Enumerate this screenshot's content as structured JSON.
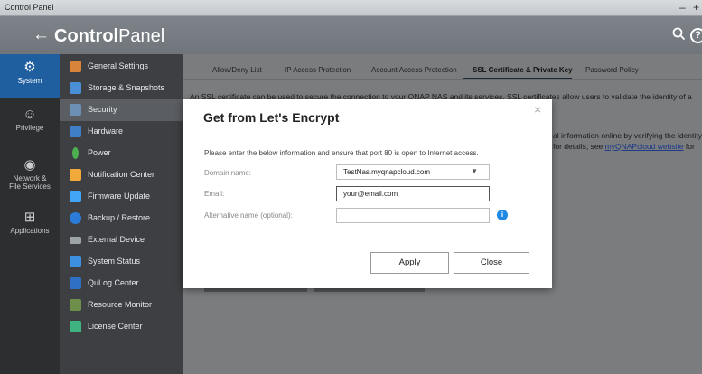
{
  "window": {
    "title": "Control Panel",
    "minimize": "–",
    "more": "+"
  },
  "header": {
    "back": "←",
    "title_bold": "Control",
    "title_rest": "Panel",
    "search": "🔍",
    "help": "?"
  },
  "rail": [
    {
      "label": "System",
      "icon": "⚙"
    },
    {
      "label": "Privilege",
      "icon": "☺"
    },
    {
      "label": "Network &",
      "label2": "File Services",
      "icon": "◉"
    },
    {
      "label": "Applications",
      "icon": "⊞"
    }
  ],
  "menu": [
    {
      "label": "General Settings",
      "color": "#d9843b"
    },
    {
      "label": "Storage & Snapshots",
      "color": "#4a8fd6"
    },
    {
      "label": "Security",
      "color": "#6d8fb3"
    },
    {
      "label": "Hardware",
      "color": "#3f7fc7"
    },
    {
      "label": "Power",
      "color": "#4caf50"
    },
    {
      "label": "Notification Center",
      "color": "#f2a93b"
    },
    {
      "label": "Firmware Update",
      "color": "#42a5f5"
    },
    {
      "label": "Backup / Restore",
      "color": "#2b7bd8"
    },
    {
      "label": "External Device",
      "color": "#9ea3a8"
    },
    {
      "label": "System Status",
      "color": "#3d8fe0"
    },
    {
      "label": "QuLog Center",
      "color": "#2f6fc4"
    },
    {
      "label": "Resource Monitor",
      "color": "#6d8f4a"
    },
    {
      "label": "License Center",
      "color": "#3fb37f"
    }
  ],
  "tabs": [
    {
      "label": "Allow/Deny List"
    },
    {
      "label": "IP Access Protection"
    },
    {
      "label": "Account Access Protection"
    },
    {
      "label": "SSL Certificate & Private Key"
    },
    {
      "label": "Password Policy"
    }
  ],
  "content": {
    "line1": "An SSL certificate can be used to secure the connection to your QNAP NAS and its services. SSL certificates allow users to validate the identity of a",
    "line2": "al information online by verifying the identity",
    "line3a": "for details, see ",
    "line3_link": "myQNAPcloud website",
    "line3b": " for"
  },
  "modal": {
    "title": "Get from Let's Encrypt",
    "close": "×",
    "instructions": "Please enter the below information and ensure that port 80 is open to Internet access.",
    "domain_label": "Domain name:",
    "domain_value": "TestNas.myqnapcloud.com",
    "email_label": "Email:",
    "email_value": "your@email.com",
    "altname_label": "Alternative name (optional):",
    "altname_value": "",
    "info": "i",
    "apply": "Apply",
    "close_button": "Close"
  }
}
